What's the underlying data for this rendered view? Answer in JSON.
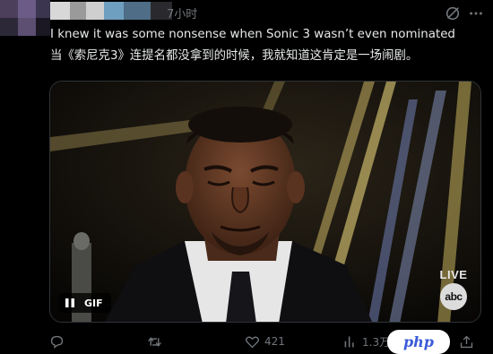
{
  "post": {
    "timestamp": "7小时",
    "text_lines": [
      "I knew it was some nonsense when Sonic 3 wasn’t even nominated",
      "当《索尼克3》连提名都没拿到的时候，我就知道这肯定是一场闹剧。"
    ]
  },
  "media": {
    "gif_label": "GIF",
    "live_label": "LIVE",
    "network_logo": "abc"
  },
  "actions": {
    "reply": {
      "icon": "reply-icon",
      "count": ""
    },
    "repost": {
      "icon": "repost-icon",
      "count": ""
    },
    "like": {
      "icon": "heart-icon",
      "count": "421"
    },
    "views": {
      "icon": "views-icon",
      "count": "1.3万"
    }
  },
  "watermark": {
    "label": "php"
  },
  "colors": {
    "background": "#000000",
    "text": "#e7e9ea",
    "muted": "#71767b",
    "border": "#2f3336",
    "watermark_accent": "#3a5bd9"
  }
}
